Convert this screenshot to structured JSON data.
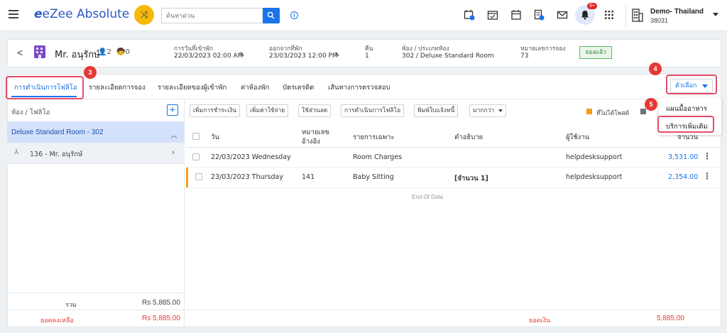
{
  "app": {
    "logo_text": "eZee Absolute",
    "logo_mark": "e",
    "search_placeholder": "ค้นหาด่วน",
    "notif_badge": "9+",
    "hotel_name": "Demo- Thailand",
    "hotel_code": "38031",
    "info": "i"
  },
  "guest": {
    "name": "Mr. อนุรักษ์",
    "adults": "2",
    "children": "0",
    "arrival_label": "การวันที่เข้าพัก",
    "arrival": "22/03/2023 02:00 AM",
    "departure_label": "ออกจากที่พัก",
    "departure": "23/03/2023 12:00 PM",
    "nights_label": "คืน",
    "nights": "1",
    "room_label": "ห้อง / ประเภทห้อง",
    "room": "302 / Deluxe Standard Room",
    "res_label": "หมายเลขการจอง",
    "res_no": "73",
    "status": "จองแล้ว"
  },
  "tabs": [
    "การดำเนินการโฟลิโอ",
    "รายละเอียดการจอง",
    "รายละเอียดของผู้เข้าพัก",
    "ค่าห้องพัก",
    "บัตรเครดิต",
    "เส้นทางการตรวจสอบ"
  ],
  "options_label": "ตัวเลือก",
  "markers": {
    "m3": "3",
    "m4": "4",
    "m5": "5"
  },
  "left": {
    "title": "ห้อง / โฟลิโอ",
    "room": "Deluxe Standard Room - 302",
    "guest_folio": "136 - Mr. อนุรักษ์",
    "total_label": "รวม",
    "total": "Rs 5,885.00",
    "balance_label": "ยอดคงเหลือ",
    "balance": "Rs 5,885.00"
  },
  "actions": [
    "เพิ่มการชำระเงิน",
    "เพิ่มค่าใช้จ่าย",
    "ใช้ส่วนลด",
    "การดำเนินการโฟลิโอ",
    "พิมพ์ใบแจ้งหนี้",
    "มากกว่า"
  ],
  "legend": {
    "unposted": "ที่ไม่ได้โพสต์",
    "orange": "#f59c1a",
    "gray": "#6b7280"
  },
  "menu": {
    "item1": "แผนมื้ออาหาร",
    "item2": "บริการเพิ่มเติม"
  },
  "table": {
    "headers": {
      "date": "วัน",
      "ref_line1": "หมายเลข",
      "ref_line2": "อ้างอิง",
      "particulars": "รายการเฉพาะ",
      "description": "คำอธิบาย",
      "user": "ผู้ใช้งาน",
      "amount": "จำนวน"
    },
    "rows": [
      {
        "date": "22/03/2023 Wednesday",
        "ref": "",
        "particulars": "Room Charges",
        "description": "",
        "user": "helpdesksupport",
        "amount": "3,531.00"
      },
      {
        "date": "23/03/2023 Thursday",
        "ref": "141",
        "particulars": "Baby Sitting",
        "description": "[จำนวน 1]",
        "user": "helpdesksupport",
        "amount": "2,354.00"
      }
    ],
    "end_text": "End Of Data",
    "balance_label": "ยอดเงิน",
    "balance": "5,885.00"
  },
  "colors": {
    "accent": "#1a73e8",
    "highlight": "#e84a6a",
    "marker": "#e53935",
    "status": "#5cb85c"
  }
}
